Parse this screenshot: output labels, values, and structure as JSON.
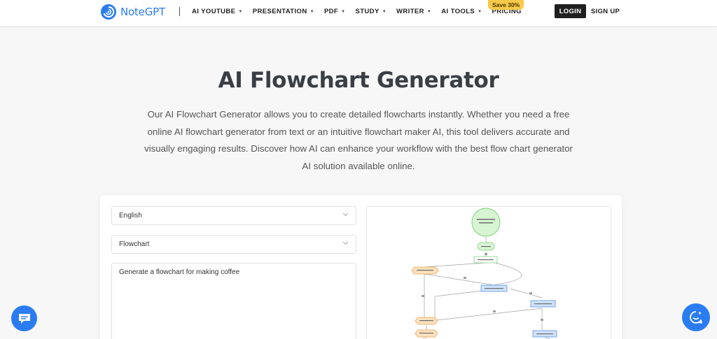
{
  "header": {
    "logo_text": "NoteGPT",
    "nav": [
      {
        "label": "AI YOUTUBE"
      },
      {
        "label": "PRESENTATION"
      },
      {
        "label": "PDF"
      },
      {
        "label": "STUDY"
      },
      {
        "label": "WRITER"
      },
      {
        "label": "AI TOOLS"
      },
      {
        "label": "PRICING"
      }
    ],
    "save_badge": "Save 30%",
    "login": "LOGIN",
    "signup": "SIGN UP"
  },
  "hero": {
    "title": "AI Flowchart Generator",
    "description": "Our AI Flowchart Generator allows you to create detailed flowcharts instantly. Whether you need a free online AI flowchart generator from text or an intuitive flowchart maker AI, this tool delivers accurate and visually engaging results. Discover how AI can enhance your workflow with the best flow chart generator AI solution available online."
  },
  "form": {
    "language": "English",
    "chart_type": "Flowchart",
    "prompt": "Generate a flowchart for making coffee"
  },
  "icons": {
    "logo": "notegpt-logo-icon",
    "chat": "chat-bubble-icon",
    "assistant": "assistant-icon",
    "dropdown": "chevron-down-icon"
  },
  "colors": {
    "brand": "#2b7cf2",
    "badge": "#f7c948",
    "node_green": "#d8f5d3",
    "node_orange": "#fde2bd",
    "node_blue": "#cfe2fb"
  }
}
